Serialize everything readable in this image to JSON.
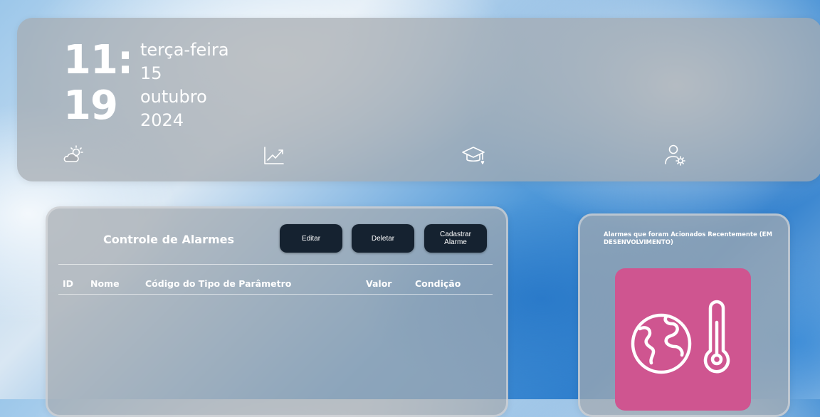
{
  "header": {
    "time_hour": "11:",
    "time_minute": "19",
    "weekday": "terça-feira",
    "day": "15",
    "month": "outubro",
    "year": "2024",
    "nav_icons": [
      "weather-icon",
      "chart-trend-icon",
      "graduation-cap-icon",
      "user-settings-icon"
    ]
  },
  "alarms": {
    "title": "Controle de Alarmes",
    "buttons": {
      "edit": "Editar",
      "delete": "Deletar",
      "register": "Cadastrar Alarme"
    },
    "columns": [
      "ID",
      "Nome",
      "Código do Tipo de Parâmetro",
      "Valor",
      "Condição"
    ],
    "rows": []
  },
  "recent": {
    "title": "Alarmes que foram Acionados Recentemente (EM DESENVOLVIMENTO)",
    "tile_icon": "globe-thermometer-icon",
    "tile_color": "#cf5590"
  }
}
